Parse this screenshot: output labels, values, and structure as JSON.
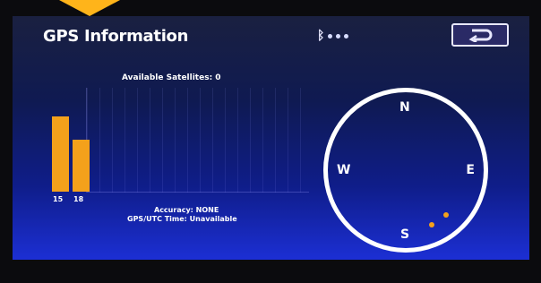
{
  "header": {
    "title": "GPS Information"
  },
  "status": {
    "bluetooth_icon": "bluetooth-icon",
    "signal_dots": 3
  },
  "back_button": {
    "icon": "back-arrow-icon"
  },
  "satellites": {
    "available_label": "Available Satellites: 0",
    "bars": [
      {
        "id": "15",
        "level": 0.72
      },
      {
        "id": "18",
        "level": 0.5
      }
    ]
  },
  "info": {
    "accuracy": "Accuracy: NONE",
    "gps_utc": "GPS/UTC Time: Unavailable"
  },
  "compass": {
    "n": "N",
    "e": "E",
    "s": "S",
    "w": "W"
  },
  "colors": {
    "bar": "#f4a11b",
    "background": "#0f1d8a",
    "text": "#ffffff"
  }
}
